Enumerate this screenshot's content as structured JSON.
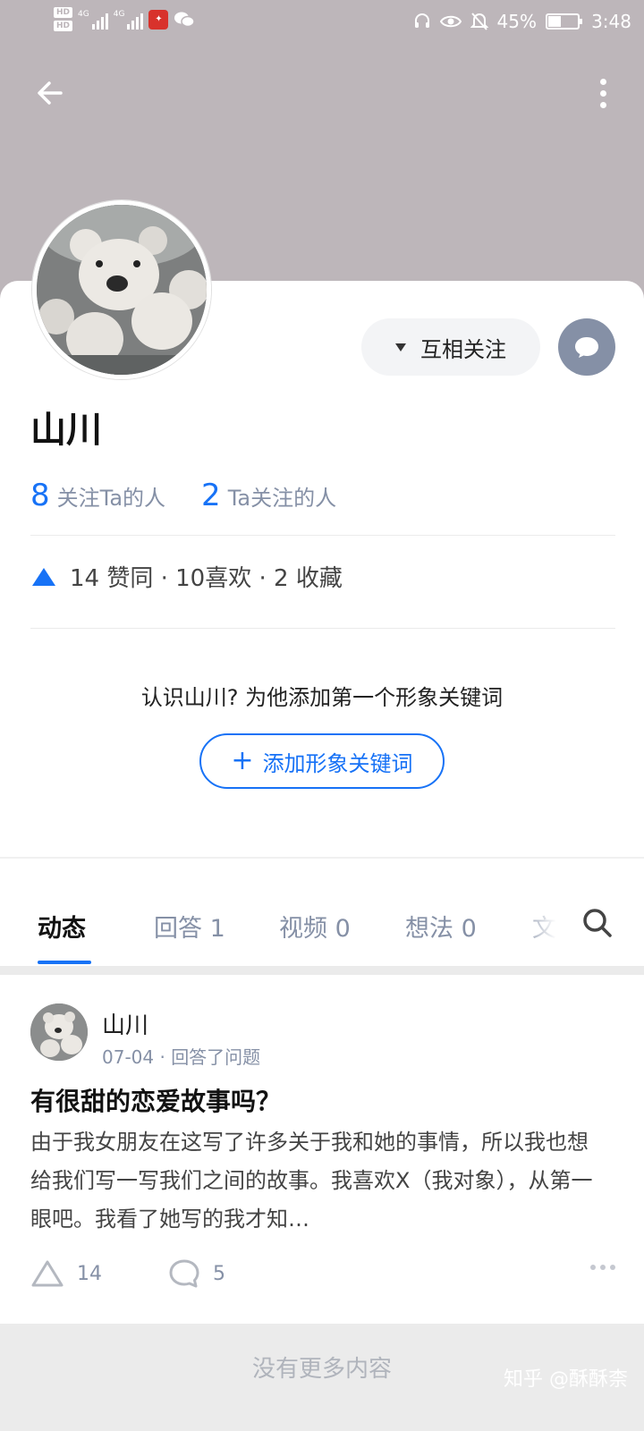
{
  "status_bar": {
    "hd_badges": [
      "HD",
      "HD"
    ],
    "network_labels": [
      "4G",
      "4G"
    ],
    "battery_percent": "45%",
    "battery_level": 0.45,
    "time": "3:48"
  },
  "header": {
    "back_icon": "arrow-left-icon",
    "more_icon": "more-vertical-icon",
    "cover_color": "#bdb6ba"
  },
  "profile": {
    "name": "山川",
    "follow_button_label": "互相关注",
    "followers_count": "8",
    "followers_label": "关注Ta的人",
    "following_count": "2",
    "following_label": "Ta关注的人",
    "achievements": "14 赞同 · 10喜欢 · 2 收藏",
    "keyword_prompt": "认识山川? 为他添加第一个形象关键词",
    "keyword_button_plus": "+",
    "keyword_button_label": "添加形象关键词"
  },
  "tabs": [
    {
      "label": "动态",
      "active": true
    },
    {
      "label": "回答 1",
      "active": false
    },
    {
      "label": "视频 0",
      "active": false
    },
    {
      "label": "想法 0",
      "active": false
    },
    {
      "label": "文",
      "active": false
    }
  ],
  "feed": [
    {
      "author": "山川",
      "meta": "07-04 · 回答了问题",
      "title": "有很甜的恋爱故事吗？",
      "excerpt": "由于我女朋友在这写了许多关于我和她的事情，所以我也想给我们写一写我们之间的故事。我喜欢X（我对象），从第一眼吧。我看了她写的我才知…",
      "upvotes": "14",
      "comments": "5"
    }
  ],
  "footer": {
    "no_more": "没有更多内容",
    "watermark": "知乎 @酥酥柰"
  },
  "colors": {
    "accent": "#1772f6",
    "muted": "#8590a6",
    "message_button": "#8590a6"
  }
}
